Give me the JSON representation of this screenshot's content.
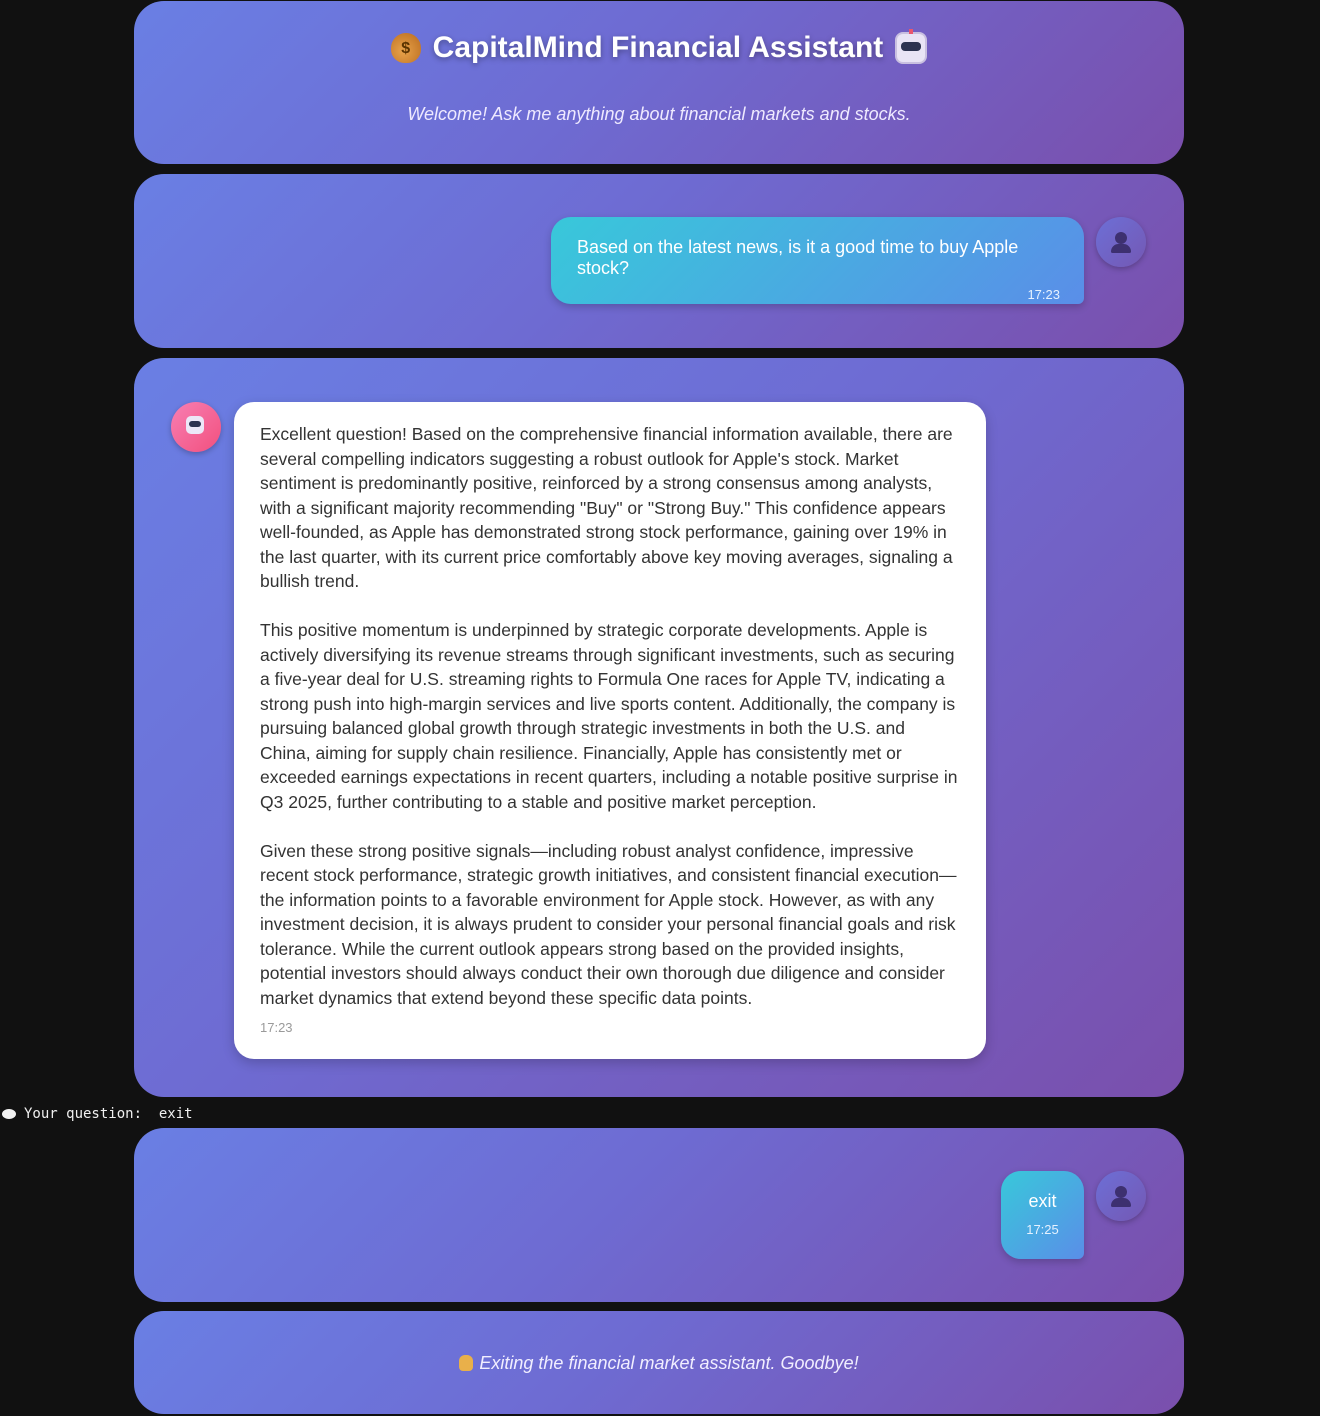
{
  "header": {
    "title": "CapitalMind Financial Assistant",
    "subtitle": "Welcome! Ask me anything about financial markets and stocks.",
    "icons": [
      "money-bag-icon",
      "robot-icon"
    ]
  },
  "messages": [
    {
      "role": "user",
      "text": "Based on the latest news, is it a good time to buy Apple stock?",
      "time": "17:23"
    },
    {
      "role": "assistant",
      "paragraphs": [
        "Excellent question! Based on the comprehensive financial information available, there are several compelling indicators suggesting a robust outlook for Apple's stock. Market sentiment is predominantly positive, reinforced by a strong consensus among analysts, with a significant majority recommending \"Buy\" or \"Strong Buy.\" This confidence appears well-founded, as Apple has demonstrated strong stock performance, gaining over 19% in the last quarter, with its current price comfortably above key moving averages, signaling a bullish trend.",
        "This positive momentum is underpinned by strategic corporate developments. Apple is actively diversifying its revenue streams through significant investments, such as securing a five-year deal for U.S. streaming rights to Formula One races for Apple TV, indicating a strong push into high-margin services and live sports content. Additionally, the company is pursuing balanced global growth through strategic investments in both the U.S. and China, aiming for supply chain resilience. Financially, Apple has consistently met or exceeded earnings expectations in recent quarters, including a notable positive surprise in Q3 2025, further contributing to a stable and positive market perception.",
        "Given these strong positive signals—including robust analyst confidence, impressive recent stock performance, strategic growth initiatives, and consistent financial execution—the information points to a favorable environment for Apple stock. However, as with any investment decision, it is always prudent to consider your personal financial goals and risk tolerance. While the current outlook appears strong based on the provided insights, potential investors should always conduct their own thorough due diligence and consider market dynamics that extend beyond these specific data points."
      ],
      "time": "17:23"
    },
    {
      "role": "user",
      "text": "exit",
      "time": "17:25"
    }
  ],
  "terminal": {
    "prompt": "Your question:",
    "input": "exit",
    "icon": "speech-bubble-icon"
  },
  "goodbye": {
    "text": "Exiting the financial market assistant. Goodbye!",
    "icon": "waving-hand-icon"
  },
  "colors": {
    "page_background": "#111111",
    "panel_gradient_start": "#6a7fe4",
    "panel_gradient_end": "#7a4fac",
    "user_bubble_start": "#38c8da",
    "user_bubble_end": "#5a8ee8",
    "bot_avatar": "#f2507e"
  }
}
